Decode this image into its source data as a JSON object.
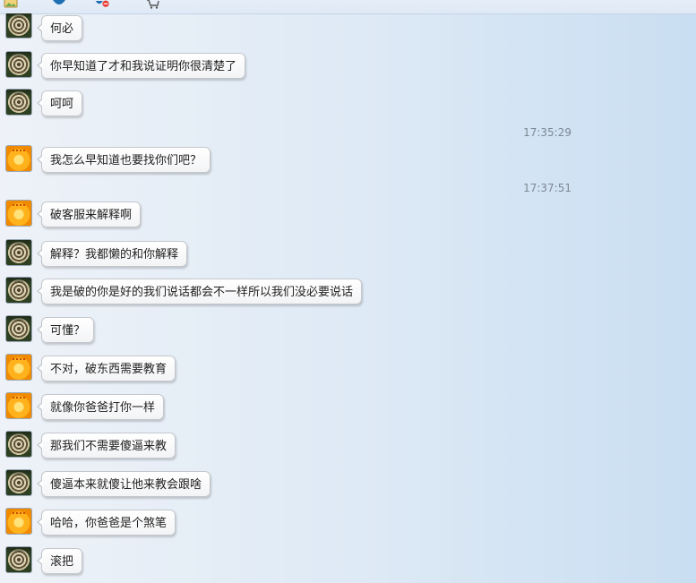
{
  "toolbar": {
    "icons": [
      "image-icon",
      "user-icon",
      "block-user-icon",
      "cart-icon"
    ],
    "accent": "#1f6fb5",
    "alert": "#e8362d"
  },
  "chat": {
    "avatars": {
      "coil": "mosquito-coil-avatar",
      "flower": "orange-flower-avatar"
    },
    "timestamps": [
      "17:35:29",
      "17:37:51"
    ],
    "messages": [
      {
        "sender": "coil",
        "text": "何必"
      },
      {
        "sender": "coil",
        "text": "你早知道了才和我说证明你很清楚了"
      },
      {
        "sender": "coil",
        "text": "呵呵"
      },
      {
        "sender": "flower",
        "text": "我怎么早知道也要找你们吧？"
      },
      {
        "sender": "flower",
        "text": "破客服来解释啊"
      },
      {
        "sender": "coil",
        "text": "解释？我都懒的和你解释"
      },
      {
        "sender": "coil",
        "text": "我是破的你是好的我们说话都会不一样所以我们没必要说话"
      },
      {
        "sender": "coil",
        "text": "可懂？"
      },
      {
        "sender": "flower",
        "text": "不对，破东西需要教育"
      },
      {
        "sender": "flower",
        "text": "就像你爸爸打你一样"
      },
      {
        "sender": "coil",
        "text": "那我们不需要傻逼来教"
      },
      {
        "sender": "coil",
        "text": "傻逼本来就傻让他来教会跟啥"
      },
      {
        "sender": "flower",
        "text": "哈哈，你爸爸是个煞笔"
      },
      {
        "sender": "coil",
        "text": "滚把"
      }
    ]
  }
}
